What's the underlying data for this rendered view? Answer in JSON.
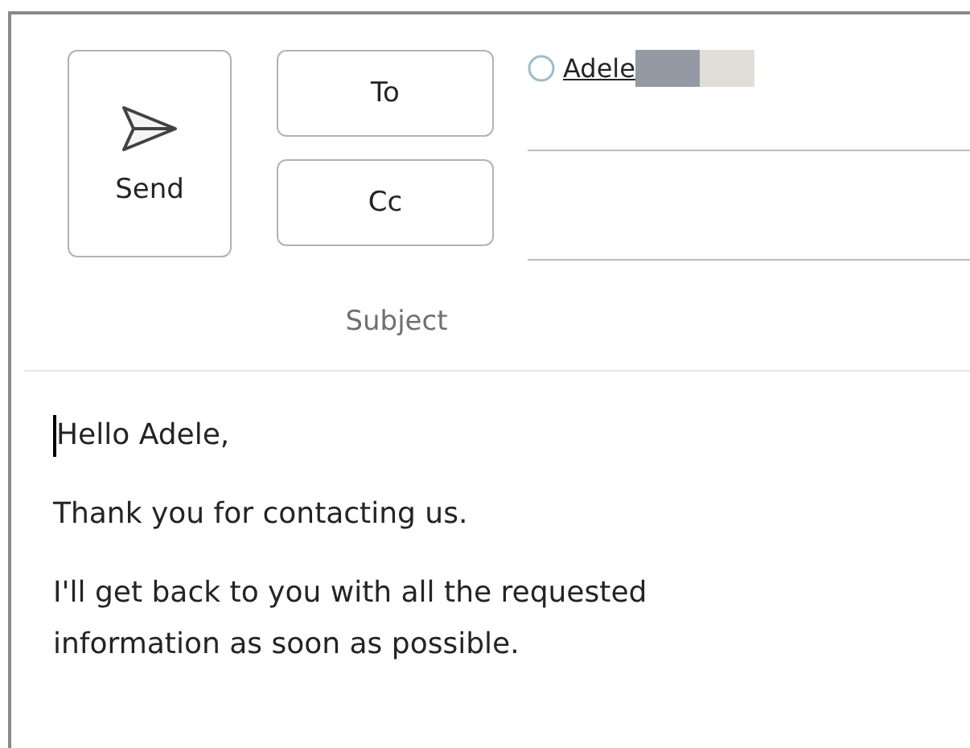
{
  "send_button": {
    "label": "Send"
  },
  "address_buttons": [
    {
      "label": "To"
    },
    {
      "label": "Cc"
    }
  ],
  "recipients": {
    "to": [
      {
        "name": "Adele"
      }
    ]
  },
  "subject": {
    "placeholder": "Subject"
  },
  "body": {
    "paragraphs": [
      [
        "Hello Adele,"
      ],
      [
        "Thank you for contacting us."
      ],
      [
        "I'll get back to you with all the requested",
        "information as soon as possible."
      ]
    ]
  }
}
